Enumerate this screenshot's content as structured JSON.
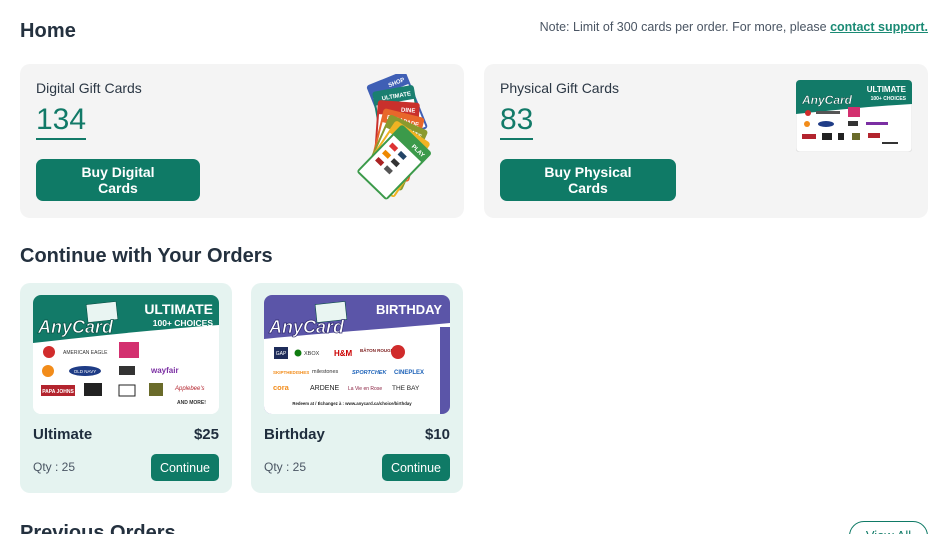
{
  "header": {
    "title": "Home",
    "note_prefix": "Note: Limit of 300 cards per order. For more, please ",
    "note_link": "contact support."
  },
  "summary": {
    "digital": {
      "label": "Digital Gift Cards",
      "count": "134",
      "button": "Buy Digital Cards"
    },
    "physical": {
      "label": "Physical Gift Cards",
      "count": "83",
      "button": "Buy Physical Cards"
    }
  },
  "fan_labels": [
    "SHOP",
    "ULTIMATE",
    "DINE",
    "ESCAPADE",
    "EATS",
    "RIDE",
    "PLAY"
  ],
  "continue_section": {
    "title": "Continue with Your Orders",
    "orders": [
      {
        "name": "Ultimate",
        "price": "$25",
        "qty": "Qty : 25",
        "button": "Continue",
        "card_brand": "AnyCard",
        "card_title": "ULTIMATE",
        "card_subtitle": "100+ CHOICES",
        "card_logos": [
          "AMERICAN EAGLE",
          "OLD NAVY",
          "wayfair",
          "PAPA JOHNS",
          "Foot Locker",
          "Applebee's",
          "AND MORE!"
        ]
      },
      {
        "name": "Birthday",
        "price": "$10",
        "qty": "Qty : 25",
        "button": "Continue",
        "card_brand": "AnyCard",
        "card_title": "BIRTHDAY",
        "card_logos": [
          "GAP",
          "XBOX",
          "H&M",
          "BÂTON ROUGE",
          "SKIPTHEDISHES",
          "milestones",
          "SPORTCHEK",
          "CINEPLEX",
          "cora",
          "ARDENE",
          "La Vie en Rose",
          "THE BAY"
        ],
        "card_footer": "Redeem at / Échangez à : www.anycard.ca/choice/birthday"
      }
    ]
  },
  "previous_section": {
    "title": "Previous Orders",
    "button": "View All"
  },
  "colors": {
    "accent": "#0f7a66",
    "card_bg": "#f4f4f4",
    "order_bg": "#e5f3f0",
    "birthday": "#5b55a8"
  }
}
